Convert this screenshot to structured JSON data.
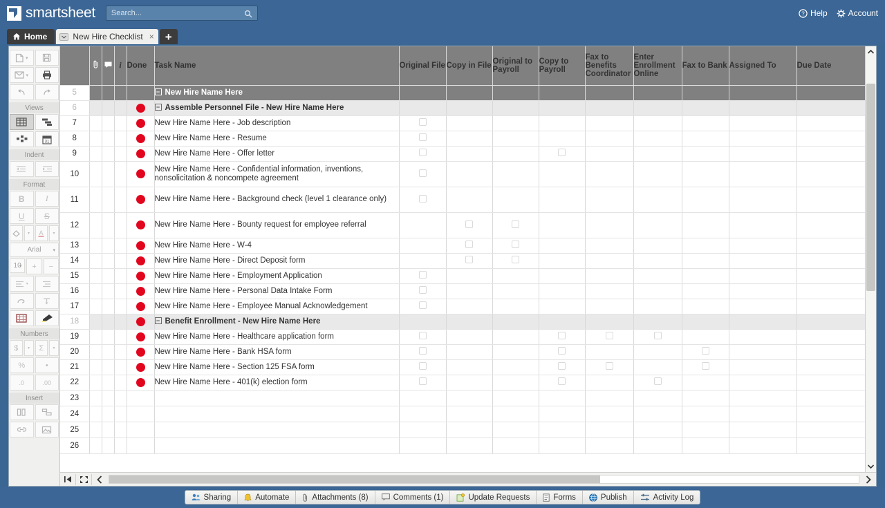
{
  "header": {
    "logo_text": "smartsheet",
    "logo_icon": "smartsheet-logo-icon",
    "search_placeholder": "Search...",
    "search_value": "",
    "search_icon": "search-icon",
    "help_label": "Help",
    "help_icon": "question-circle-icon",
    "account_label": "Account",
    "account_icon": "gear-icon",
    "brand_blue": "#3b6695"
  },
  "tabs": {
    "home_label": "Home",
    "home_icon": "home-icon",
    "sheet_label": "New Hire Checklist",
    "sheet_caret_icon": "chevron-down-icon",
    "sheet_close_icon": "close-icon",
    "add_label": "+",
    "add_icon": "plus-icon"
  },
  "toolbar": {
    "sections": [
      {
        "name": "",
        "label": ""
      },
      {
        "name": "views",
        "label": "Views"
      },
      {
        "name": "indent",
        "label": "Indent"
      },
      {
        "name": "format",
        "label": "Format"
      },
      {
        "name": "numbers",
        "label": "Numbers"
      },
      {
        "name": "insert",
        "label": "Insert"
      }
    ],
    "font_name": "Arial",
    "font_size": "10",
    "buttons": [
      "new-icon",
      "save-icon",
      "email-icon",
      "print-icon",
      "undo-icon",
      "redo-icon",
      "grid-view-icon",
      "gantt-view-icon",
      "card-view-icon",
      "calendar-view-icon",
      "indent-icon",
      "outdent-icon",
      "bold-icon",
      "italic-icon",
      "underline-icon",
      "strikethrough-icon",
      "fill-color-icon",
      "font-color-icon",
      "align-icon",
      "vertical-align-icon",
      "wrap-text-icon",
      "vertical-align-top-icon",
      "borders-icon",
      "format-painter-icon",
      "currency-icon",
      "sum-icon",
      "percent-icon",
      "thousands-icon",
      "decrease-decimal-icon",
      "increase-decimal-icon",
      "insert-column-icon",
      "insert-row-icon",
      "link-icon",
      "image-icon"
    ]
  },
  "grid": {
    "columns": [
      {
        "key": "rownum",
        "label": "",
        "icon": ""
      },
      {
        "key": "attachment",
        "label": "",
        "icon": "paperclip-icon"
      },
      {
        "key": "comment",
        "label": "",
        "icon": "comment-icon"
      },
      {
        "key": "info",
        "label": "i",
        "icon": "info-icon"
      },
      {
        "key": "done",
        "label": "Done",
        "icon": ""
      },
      {
        "key": "task_name",
        "label": "Task Name",
        "icon": ""
      },
      {
        "key": "original_file",
        "label": "Original File",
        "icon": ""
      },
      {
        "key": "copy_in_file",
        "label": "Copy in File",
        "icon": ""
      },
      {
        "key": "original_to_payroll",
        "label": "Original to Payroll",
        "icon": ""
      },
      {
        "key": "copy_to_payroll",
        "label": "Copy to Payroll",
        "icon": ""
      },
      {
        "key": "fax_to_benefits",
        "label": "Fax to Benefits Coordinator",
        "icon": ""
      },
      {
        "key": "enter_enrollment_online",
        "label": "Enter Enrollment Online",
        "icon": ""
      },
      {
        "key": "fax_to_bank",
        "label": "Fax to Bank",
        "icon": ""
      },
      {
        "key": "assigned_to",
        "label": "Assigned To",
        "icon": ""
      },
      {
        "key": "due_date",
        "label": "Due Date",
        "icon": ""
      }
    ],
    "rows": [
      {
        "num": "5",
        "type": "head",
        "done": false,
        "indent": 0,
        "task": "New Hire Name Here",
        "expander": "minus",
        "checks": [
          false,
          false,
          false,
          false,
          false,
          false,
          false
        ]
      },
      {
        "num": "6",
        "type": "section",
        "done": true,
        "indent": 1,
        "task": "Assemble Personnel File - New Hire Name Here",
        "expander": "minus",
        "checks": [
          false,
          false,
          false,
          false,
          false,
          false,
          false
        ]
      },
      {
        "num": "7",
        "type": "task",
        "done": true,
        "indent": 2,
        "task": "New Hire Name Here - Job description",
        "expander": "",
        "checks": [
          true,
          false,
          false,
          false,
          false,
          false,
          false
        ]
      },
      {
        "num": "8",
        "type": "task",
        "done": true,
        "indent": 2,
        "task": "New Hire Name Here - Resume",
        "expander": "",
        "checks": [
          true,
          false,
          false,
          false,
          false,
          false,
          false
        ]
      },
      {
        "num": "9",
        "type": "task",
        "done": true,
        "indent": 2,
        "task": "New Hire Name Here - Offer letter",
        "expander": "",
        "checks": [
          true,
          false,
          false,
          true,
          false,
          false,
          false
        ]
      },
      {
        "num": "10",
        "type": "task",
        "done": true,
        "indent": 2,
        "task": "New Hire Name Here - Confidential information, inventions, nonsolicitation & noncompete agreement",
        "expander": "",
        "checks": [
          true,
          false,
          false,
          false,
          false,
          false,
          false
        ]
      },
      {
        "num": "11",
        "type": "task",
        "done": true,
        "indent": 2,
        "task": "New Hire Name Here - Background check (level 1 clearance only)",
        "expander": "",
        "checks": [
          true,
          false,
          false,
          false,
          false,
          false,
          false
        ]
      },
      {
        "num": "12",
        "type": "task",
        "done": true,
        "indent": 2,
        "task": "New Hire Name Here - Bounty request for employee referral",
        "expander": "",
        "checks": [
          false,
          true,
          true,
          false,
          false,
          false,
          false
        ]
      },
      {
        "num": "13",
        "type": "task",
        "done": true,
        "indent": 2,
        "task": "New Hire Name Here - W-4",
        "expander": "",
        "checks": [
          false,
          true,
          true,
          false,
          false,
          false,
          false
        ]
      },
      {
        "num": "14",
        "type": "task",
        "done": true,
        "indent": 2,
        "task": "New Hire Name Here - Direct Deposit form",
        "expander": "",
        "checks": [
          false,
          true,
          true,
          false,
          false,
          false,
          false
        ]
      },
      {
        "num": "15",
        "type": "task",
        "done": true,
        "indent": 2,
        "task": "New Hire Name Here - Employment Application",
        "expander": "",
        "checks": [
          true,
          false,
          false,
          false,
          false,
          false,
          false
        ]
      },
      {
        "num": "16",
        "type": "task",
        "done": true,
        "indent": 2,
        "task": "New Hire Name Here - Personal Data Intake Form",
        "expander": "",
        "checks": [
          true,
          false,
          false,
          false,
          false,
          false,
          false
        ]
      },
      {
        "num": "17",
        "type": "task",
        "done": true,
        "indent": 2,
        "task": "New Hire Name Here - Employee Manual Acknowledgement",
        "expander": "",
        "checks": [
          true,
          false,
          false,
          false,
          false,
          false,
          false
        ]
      },
      {
        "num": "18",
        "type": "section",
        "done": true,
        "indent": 1,
        "task": "Benefit Enrollment - New Hire Name Here",
        "expander": "minus",
        "checks": [
          false,
          false,
          false,
          false,
          false,
          false,
          false
        ]
      },
      {
        "num": "19",
        "type": "task",
        "done": true,
        "indent": 2,
        "task": "New Hire Name Here - Healthcare application form",
        "expander": "",
        "checks": [
          true,
          false,
          false,
          true,
          true,
          true,
          false
        ]
      },
      {
        "num": "20",
        "type": "task",
        "done": true,
        "indent": 2,
        "task": "New Hire Name Here - Bank HSA form",
        "expander": "",
        "checks": [
          true,
          false,
          false,
          true,
          false,
          false,
          true
        ]
      },
      {
        "num": "21",
        "type": "task",
        "done": true,
        "indent": 2,
        "task": "New Hire Name Here - Section 125 FSA form",
        "expander": "",
        "checks": [
          true,
          false,
          false,
          true,
          true,
          false,
          true
        ]
      },
      {
        "num": "22",
        "type": "task",
        "done": true,
        "indent": 2,
        "task": "New Hire Name Here - 401(k) election form",
        "expander": "",
        "checks": [
          true,
          false,
          false,
          true,
          false,
          true,
          false
        ]
      },
      {
        "num": "23",
        "type": "empty",
        "done": false,
        "indent": 0,
        "task": "",
        "expander": "",
        "checks": [
          false,
          false,
          false,
          false,
          false,
          false,
          false
        ]
      },
      {
        "num": "24",
        "type": "empty",
        "done": false,
        "indent": 0,
        "task": "",
        "expander": "",
        "checks": [
          false,
          false,
          false,
          false,
          false,
          false,
          false
        ]
      },
      {
        "num": "25",
        "type": "empty",
        "done": false,
        "indent": 0,
        "task": "",
        "expander": "",
        "checks": [
          false,
          false,
          false,
          false,
          false,
          false,
          false
        ]
      },
      {
        "num": "26",
        "type": "empty",
        "done": false,
        "indent": 0,
        "task": "",
        "expander": "",
        "checks": [
          false,
          false,
          false,
          false,
          false,
          false,
          false
        ]
      }
    ],
    "status_dot_color": "#e2051e",
    "header_bg": "#808080"
  },
  "scroll": {
    "first_icon": "jump-to-start-icon",
    "expand_icon": "expand-icon",
    "left_icon": "chevron-left-icon",
    "right_icon": "chevron-right-icon",
    "up_icon": "chevron-up-icon",
    "down_icon": "chevron-down-icon"
  },
  "bottombar": {
    "items": [
      {
        "label": "Sharing",
        "icon": "people-icon"
      },
      {
        "label": "Automate",
        "icon": "bell-icon"
      },
      {
        "label": "Attachments (8)",
        "icon": "paperclip-icon"
      },
      {
        "label": "Comments (1)",
        "icon": "comment-icon"
      },
      {
        "label": "Update Requests",
        "icon": "update-request-icon"
      },
      {
        "label": "Forms",
        "icon": "form-icon"
      },
      {
        "label": "Publish",
        "icon": "globe-icon"
      },
      {
        "label": "Activity Log",
        "icon": "activity-log-icon"
      }
    ]
  }
}
